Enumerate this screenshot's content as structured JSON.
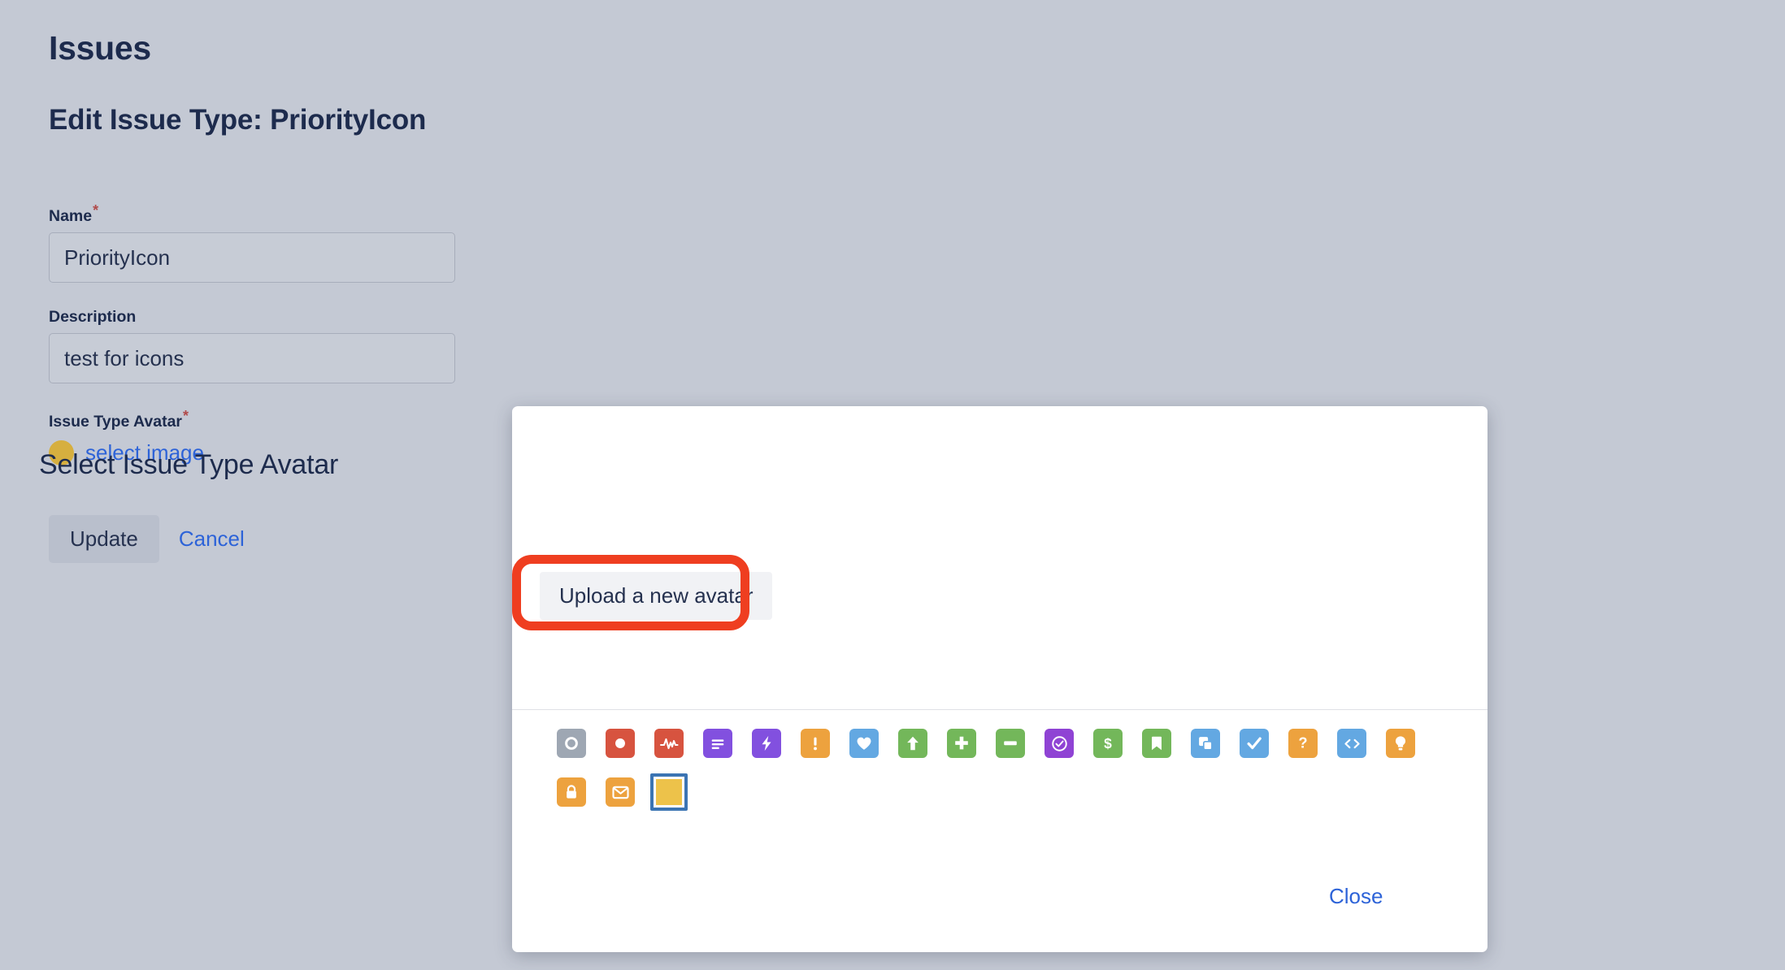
{
  "page": {
    "title": "Issues",
    "subtitle": "Edit Issue Type: PriorityIcon",
    "fields": {
      "name": {
        "label": "Name",
        "required": true,
        "value": "PriorityIcon",
        "placeholder": ""
      },
      "description": {
        "label": "Description",
        "required": false,
        "value": "test for icons",
        "placeholder": ""
      },
      "avatar": {
        "label": "Issue Type Avatar",
        "required": true,
        "swatch_color": "#d6af3f",
        "select_link": "select image"
      }
    },
    "actions": {
      "update_label": "Update",
      "cancel_label": "Cancel"
    }
  },
  "modal": {
    "title": "Select Issue Type Avatar",
    "upload_button_label": "Upload a new avatar",
    "close_label": "Close",
    "highlight_color": "#ef3e20",
    "selected_index": 20,
    "icons": [
      {
        "name": "circle-outline-icon",
        "bg": "#9ea7b3",
        "glyph": "circle-outline"
      },
      {
        "name": "circle-filled-icon",
        "bg": "#d7533f",
        "glyph": "circle-filled"
      },
      {
        "name": "pulse-icon",
        "bg": "#d7533f",
        "glyph": "pulse"
      },
      {
        "name": "text-lines-icon",
        "bg": "#8250df",
        "glyph": "lines"
      },
      {
        "name": "bolt-icon",
        "bg": "#8250df",
        "glyph": "bolt"
      },
      {
        "name": "exclamation-icon",
        "bg": "#eda23e",
        "glyph": "exclamation"
      },
      {
        "name": "heart-icon",
        "bg": "#63a8e2",
        "glyph": "heart"
      },
      {
        "name": "arrow-up-icon",
        "bg": "#73b75a",
        "glyph": "arrow-up"
      },
      {
        "name": "plus-icon",
        "bg": "#73b75a",
        "glyph": "plus"
      },
      {
        "name": "minus-icon",
        "bg": "#73b75a",
        "glyph": "minus"
      },
      {
        "name": "check-circle-icon",
        "bg": "#8f43d4",
        "glyph": "check-circle"
      },
      {
        "name": "dollar-icon",
        "bg": "#73b75a",
        "glyph": "dollar"
      },
      {
        "name": "bookmark-icon",
        "bg": "#73b75a",
        "glyph": "bookmark"
      },
      {
        "name": "copy-icon",
        "bg": "#63a8e2",
        "glyph": "copy"
      },
      {
        "name": "checkbox-icon",
        "bg": "#63a8e2",
        "glyph": "check"
      },
      {
        "name": "question-icon",
        "bg": "#eda23e",
        "glyph": "question"
      },
      {
        "name": "code-icon",
        "bg": "#63a8e2",
        "glyph": "code"
      },
      {
        "name": "lightbulb-icon",
        "bg": "#eda23e",
        "glyph": "lightbulb"
      },
      {
        "name": "lock-icon",
        "bg": "#eda23e",
        "glyph": "lock"
      },
      {
        "name": "envelope-icon",
        "bg": "#eda23e",
        "glyph": "envelope"
      },
      {
        "name": "blank-square-icon",
        "bg": "#edc24a",
        "glyph": "blank"
      }
    ]
  }
}
